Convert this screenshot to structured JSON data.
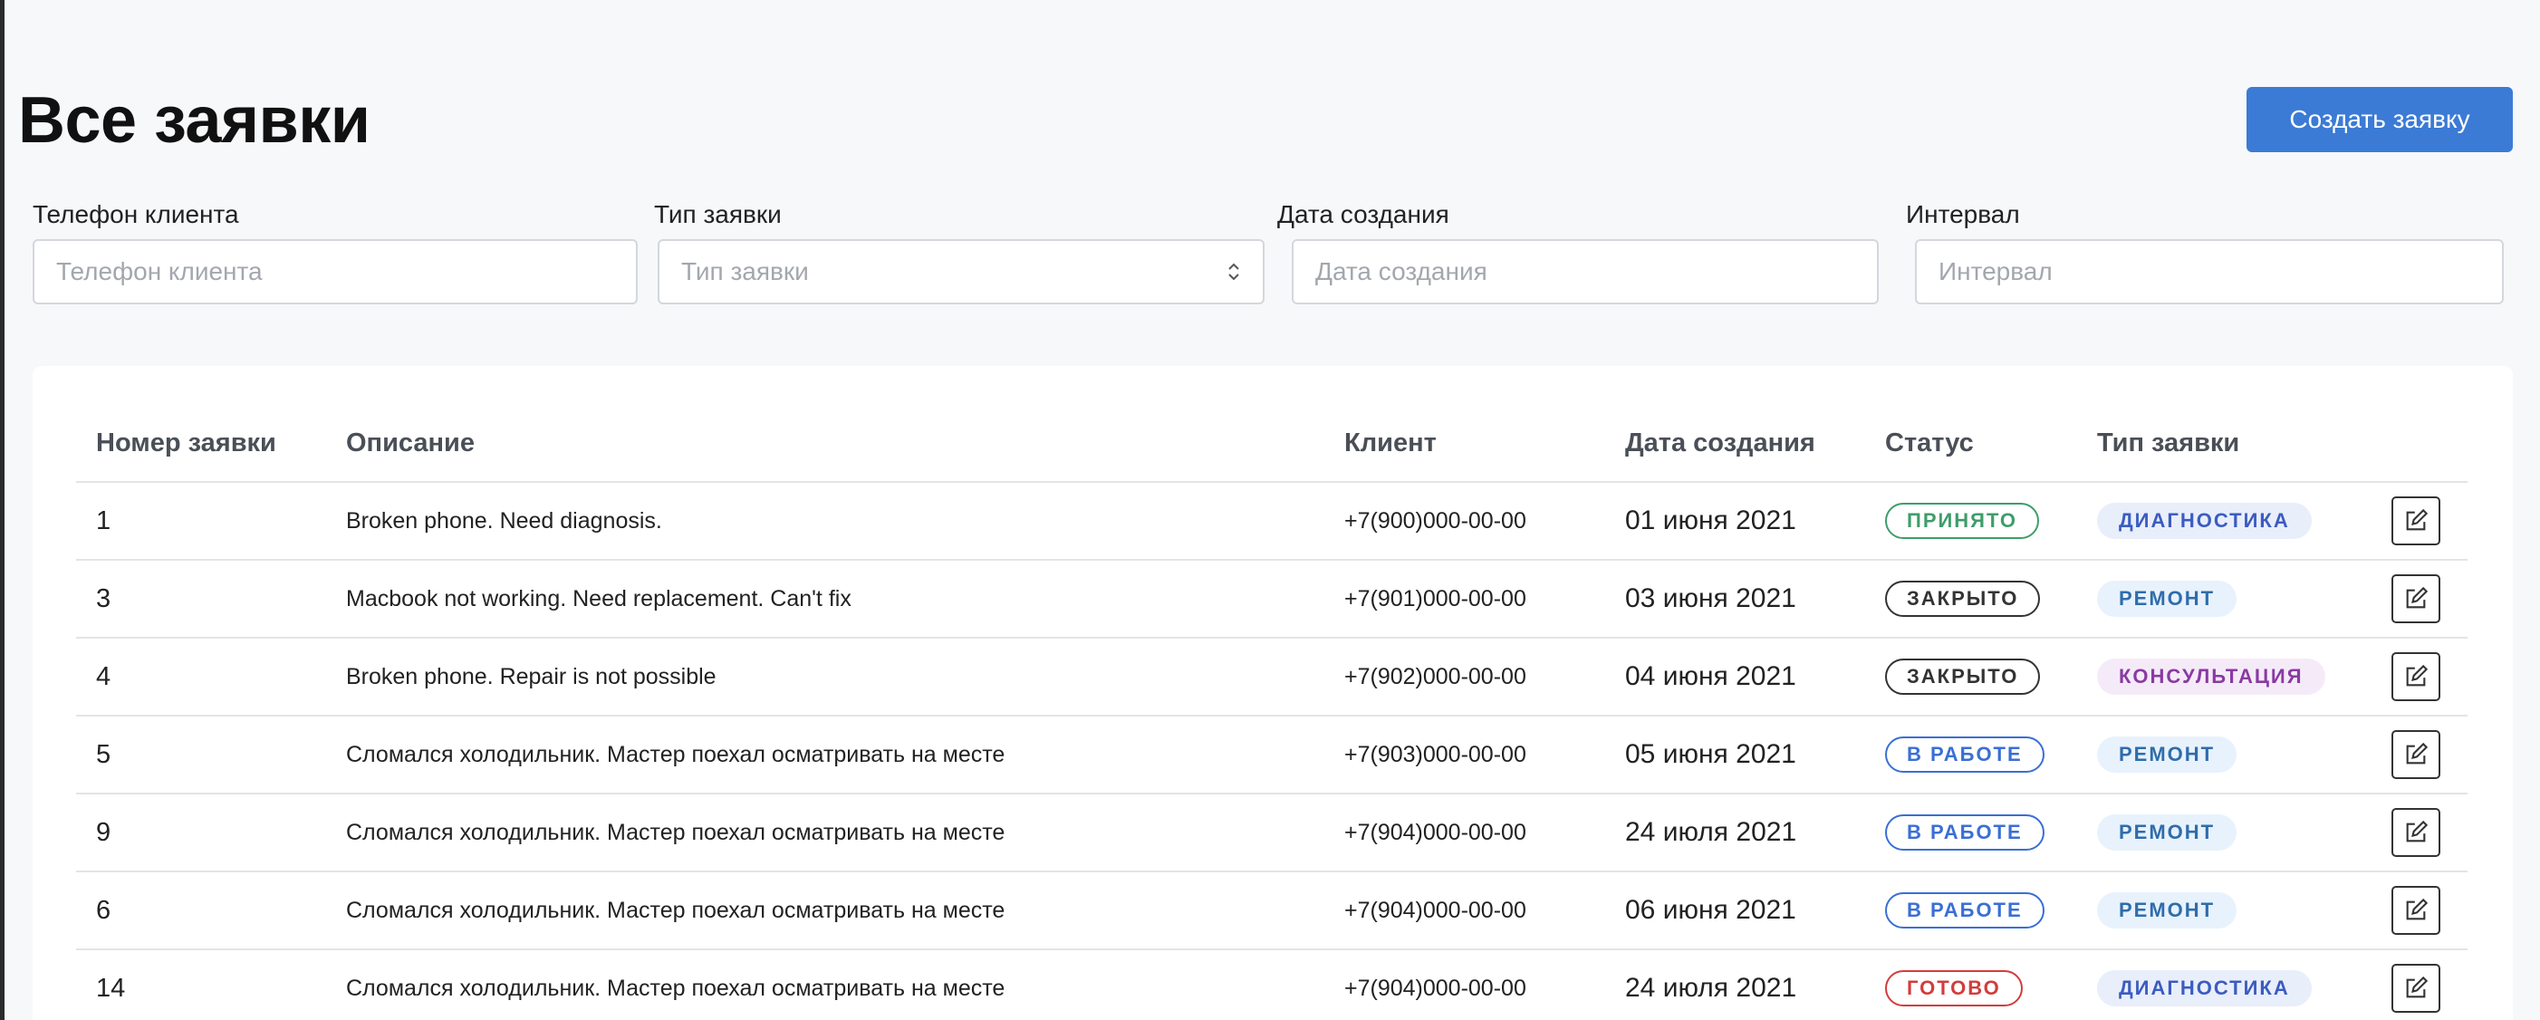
{
  "page": {
    "title": "Все заявки",
    "create_button_label": "Создать заявку"
  },
  "filters": {
    "phone": {
      "label": "Телефон клиента",
      "placeholder": "Телефон клиента"
    },
    "type": {
      "label": "Тип заявки",
      "placeholder": "Тип заявки"
    },
    "date": {
      "label": "Дата создания",
      "placeholder": "Дата создания"
    },
    "interval": {
      "label": "Интервал",
      "placeholder": "Интервал"
    }
  },
  "table": {
    "headers": {
      "num": "Номер заявки",
      "description": "Описание",
      "client": "Клиент",
      "created": "Дата создания",
      "status": "Статус",
      "type": "Тип заявки"
    },
    "rows": [
      {
        "num": "1",
        "description": "Broken phone. Need diagnosis.",
        "client": "+7(900)000-00-00",
        "created": "01 июня 2021",
        "status": "ПРИНЯТО",
        "type": "ДИАГНОСТИКА"
      },
      {
        "num": "3",
        "description": "Macbook not working. Need replacement. Can't fix",
        "client": "+7(901)000-00-00",
        "created": "03 июня 2021",
        "status": "ЗАКРЫТО",
        "type": "РЕМОНТ"
      },
      {
        "num": "4",
        "description": "Broken phone. Repair is not possible",
        "client": "+7(902)000-00-00",
        "created": "04 июня 2021",
        "status": "ЗАКРЫТО",
        "type": "КОНСУЛЬТАЦИЯ"
      },
      {
        "num": "5",
        "description": "Сломался холодильник. Мастер поехал осматривать на месте",
        "client": "+7(903)000-00-00",
        "created": "05 июня 2021",
        "status": "В РАБОТЕ",
        "type": "РЕМОНТ"
      },
      {
        "num": "9",
        "description": "Сломался холодильник. Мастер поехал осматривать на месте",
        "client": "+7(904)000-00-00",
        "created": "24 июля 2021",
        "status": "В РАБОТЕ",
        "type": "РЕМОНТ"
      },
      {
        "num": "6",
        "description": "Сломался холодильник. Мастер поехал осматривать на месте",
        "client": "+7(904)000-00-00",
        "created": "06 июня 2021",
        "status": "В РАБОТЕ",
        "type": "РЕМОНТ"
      },
      {
        "num": "14",
        "description": "Сломался холодильник. Мастер поехал осматривать на месте",
        "client": "+7(904)000-00-00",
        "created": "24 июля 2021",
        "status": "ГОТОВО",
        "type": "ДИАГНОСТИКА"
      }
    ]
  },
  "icons": {
    "edit": "edit-icon",
    "select": "chevron-updown-icon"
  },
  "colors": {
    "primary": "#3b7bd5",
    "status_accepted": "#3f9d6b",
    "status_closed": "#333333",
    "status_in_work": "#3a6fd4",
    "status_ready": "#d23d3d"
  }
}
